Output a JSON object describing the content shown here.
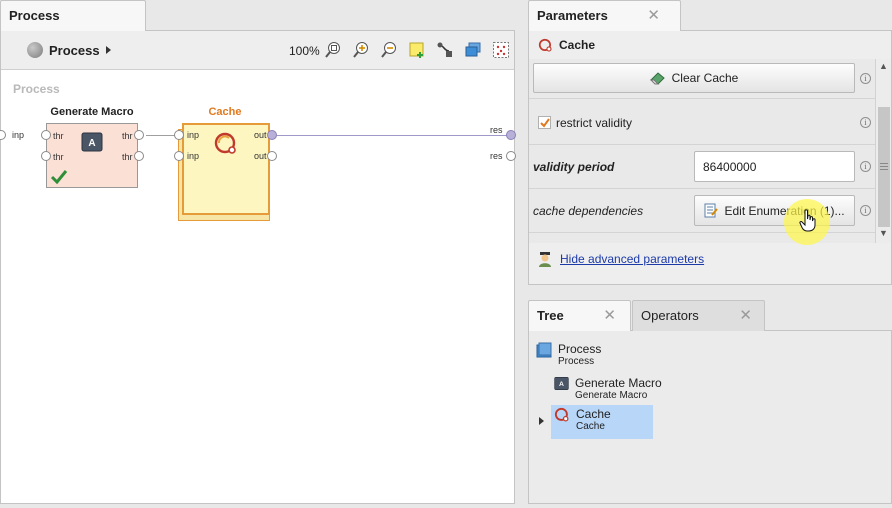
{
  "process": {
    "tab_label": "Process",
    "breadcrumb": "Process",
    "zoom": "100%",
    "toolbar_icons": [
      "zoom-fit-icon",
      "zoom-in-icon",
      "zoom-out-icon",
      "add-note-icon",
      "auto-wire-icon",
      "arrange-icon",
      "grid-icon"
    ],
    "canvas_label": "Process",
    "left_port_label": "inp",
    "right_port_labels": [
      "res",
      "res"
    ],
    "operators": [
      {
        "title": "Generate Macro",
        "title_color": "#222222",
        "box_color": "#fbe0d6",
        "in_ports": [
          "thr",
          "thr"
        ],
        "out_ports": [
          "thr",
          "thr"
        ],
        "icon": "macro-a-icon",
        "status_icon": "checkmark-icon"
      },
      {
        "title": "Cache",
        "title_color": "#e07a20",
        "box_color": "#fdf6c0",
        "in_ports": [
          "inp",
          "inp"
        ],
        "out_ports": [
          "out",
          "out"
        ],
        "icon": "cache-icon"
      }
    ]
  },
  "parameters": {
    "tab_label": "Parameters",
    "operator_name": "Cache",
    "clear_cache_label": "Clear Cache",
    "restrict_validity_label": "restrict validity",
    "restrict_validity_checked": true,
    "validity_period_label": "validity period",
    "validity_period_value": "86400000",
    "cache_dependencies_label": "cache dependencies",
    "edit_enumeration_label": "Edit Enumeration (1)...",
    "hide_advanced_label": "Hide advanced parameters"
  },
  "tree": {
    "tabs": [
      "Tree",
      "Operators"
    ],
    "nodes": [
      {
        "name": "Process",
        "sub": "Process",
        "icon": "process-icon",
        "selected": false
      },
      {
        "name": "Generate Macro",
        "sub": "Generate Macro",
        "icon": "macro-a-icon",
        "selected": false
      },
      {
        "name": "Cache",
        "sub": "Cache",
        "icon": "cache-icon",
        "selected": true
      }
    ]
  },
  "colors": {
    "accent_orange": "#e07a20",
    "selection": "#b8d6f8",
    "link": "#1c3aa8"
  }
}
